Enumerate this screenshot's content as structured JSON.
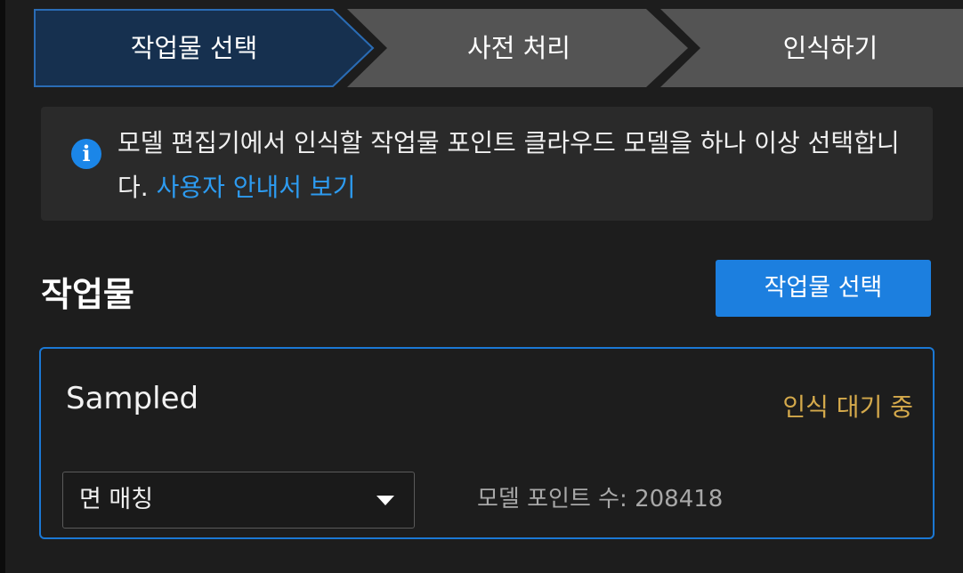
{
  "colors": {
    "background": "#1d1d1d",
    "step_active": "#16304f",
    "step_active_border": "#2a6cb5",
    "step_inactive": "#545454",
    "accent": "#1c7fdf",
    "status_pending": "#d4a94b",
    "link": "#2d9bf0"
  },
  "stepper": {
    "steps": [
      {
        "label": "작업물 선택",
        "active": true
      },
      {
        "label": "사전 처리",
        "active": false
      },
      {
        "label": "인식하기",
        "active": false
      }
    ]
  },
  "info": {
    "icon": "info-icon",
    "text": "모델 편집기에서 인식할 작업물 포인트 클라우드 모델을 하나 이상 선택합니다.",
    "link_text": "사용자 안내서 보기"
  },
  "workpieces": {
    "title": "작업물",
    "select_button": "작업물 선택",
    "items": [
      {
        "name": "Sampled",
        "status": "인식 대기 중",
        "matching_mode": "면 매칭",
        "point_count": "모델 포인트 수: 208418"
      }
    ]
  }
}
